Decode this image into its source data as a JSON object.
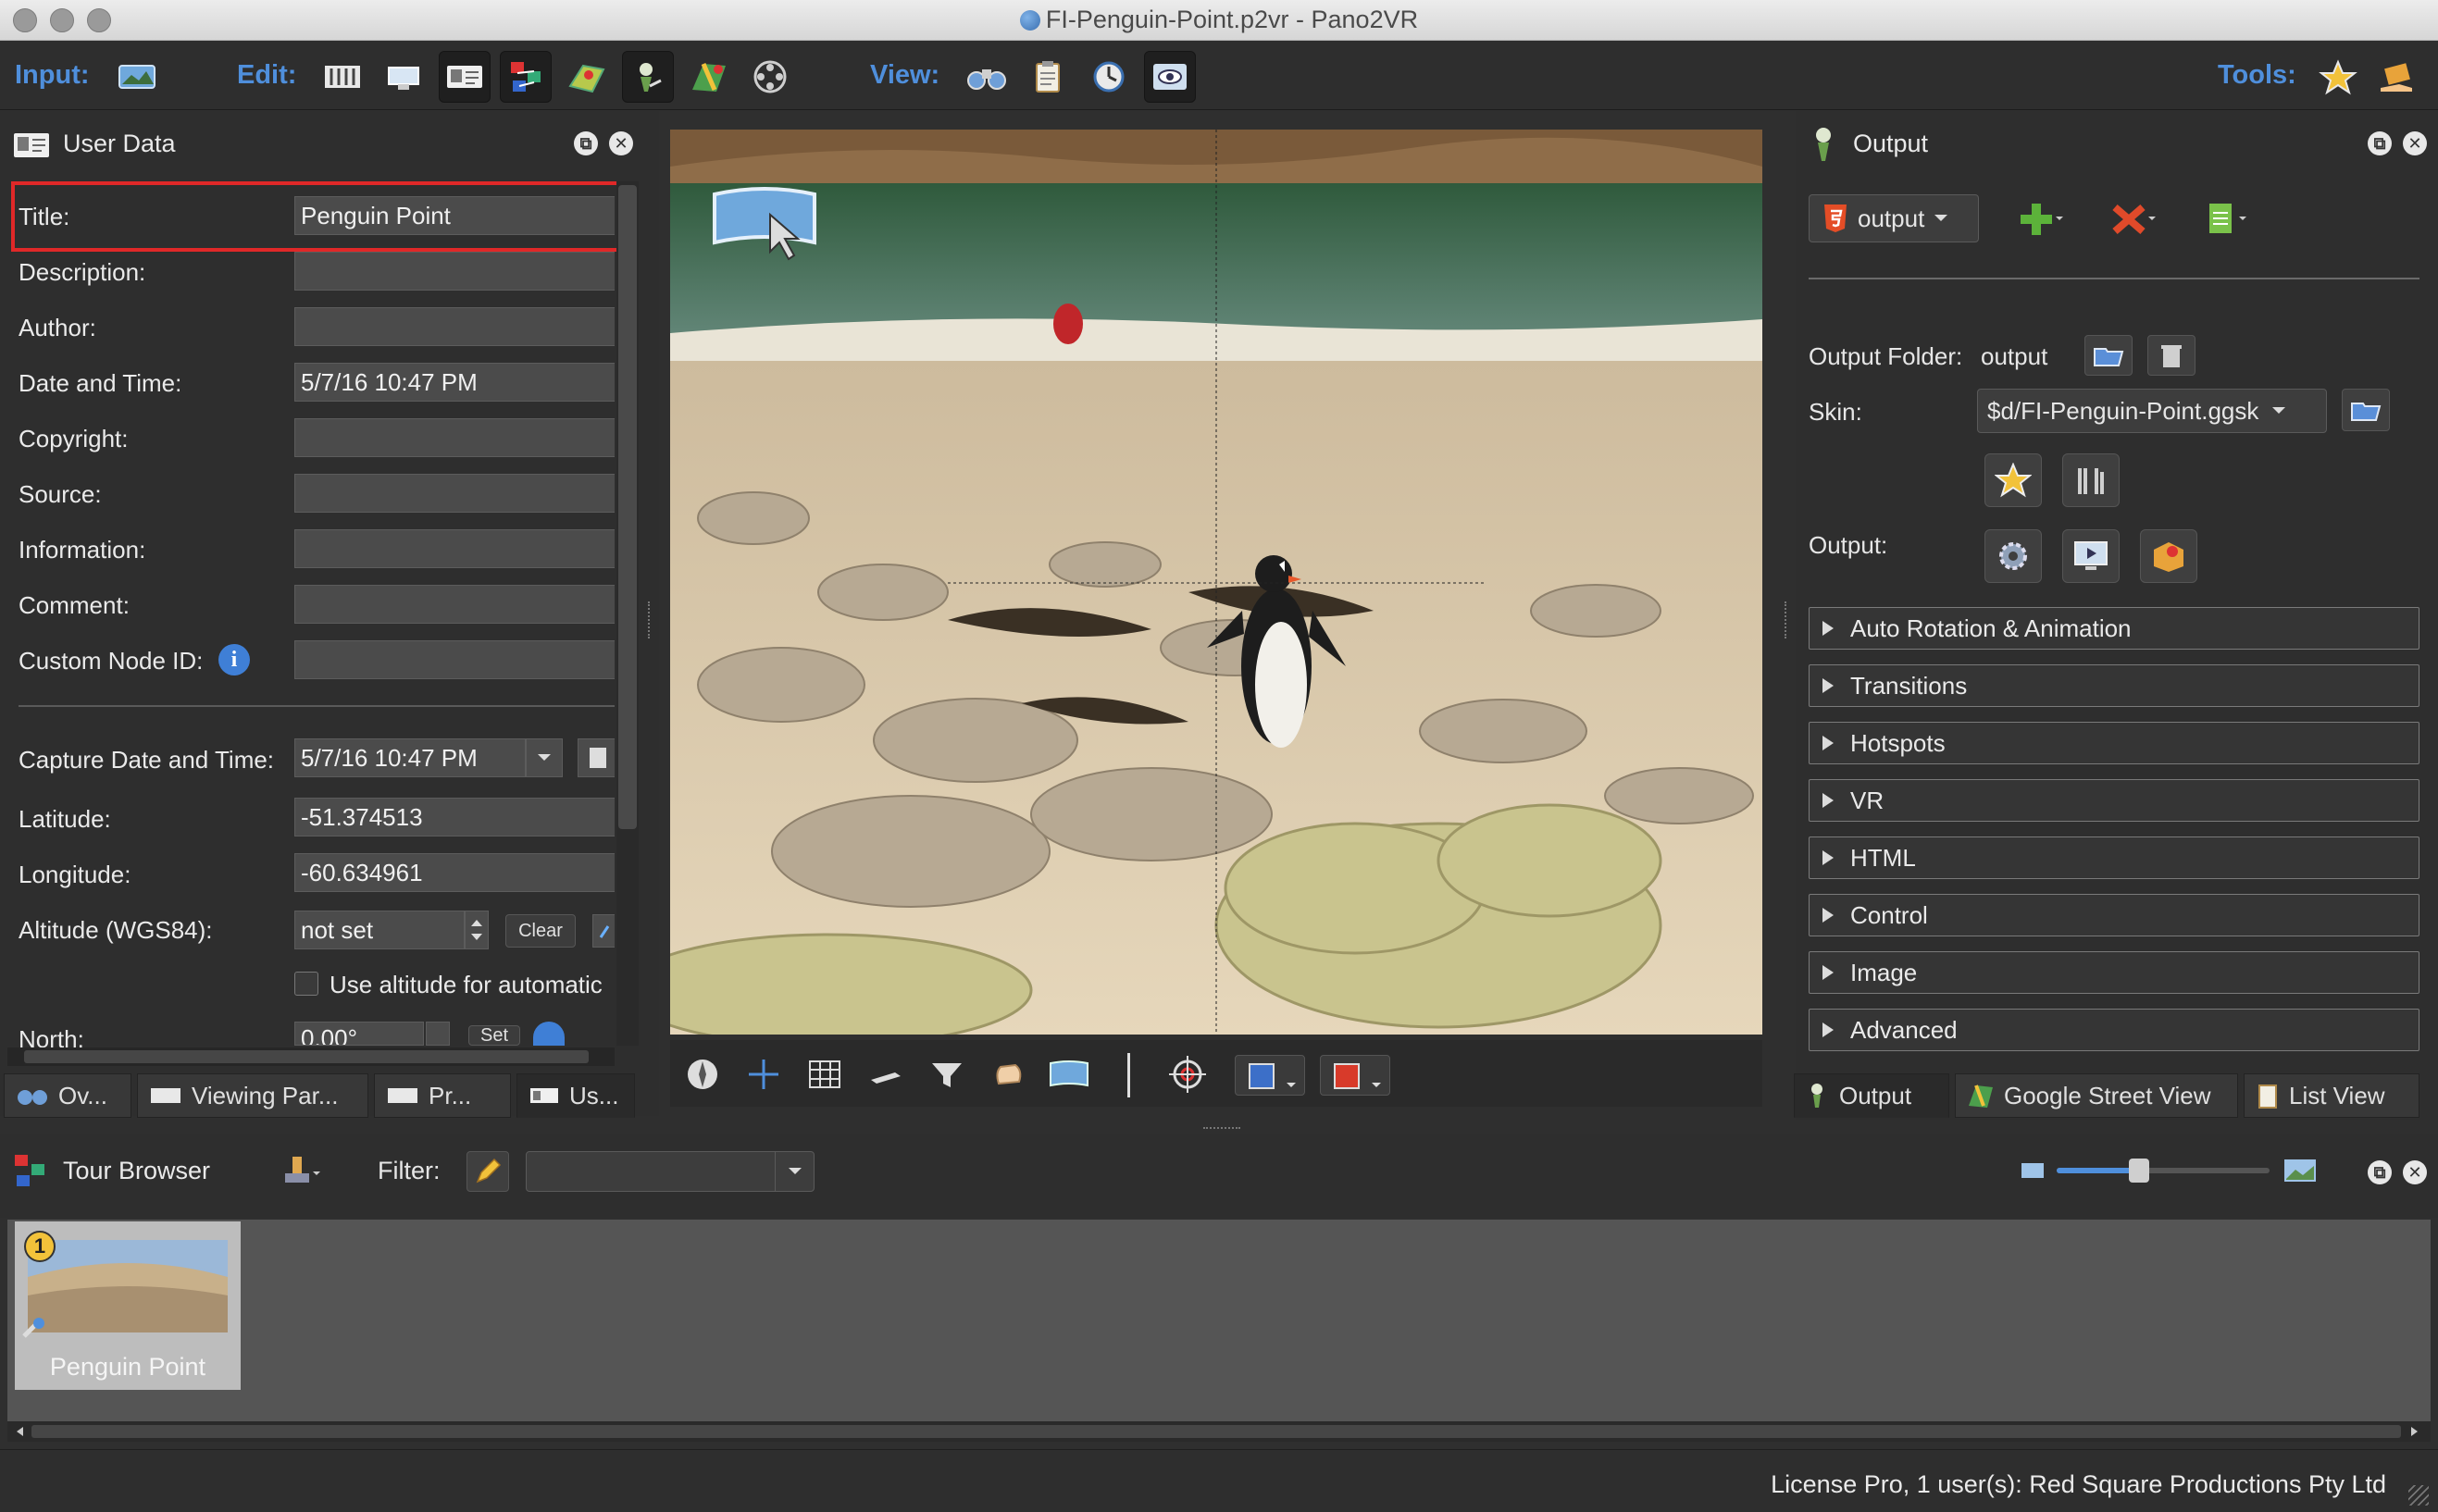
{
  "window": {
    "title": "FI-Penguin-Point.p2vr - Pano2VR"
  },
  "toolbar": {
    "input_label": "Input:",
    "edit_label": "Edit:",
    "view_label": "View:",
    "tools_label": "Tools:",
    "accent": "#4f8fdc"
  },
  "user_data": {
    "title": "User Data",
    "labels": {
      "title": "Title:",
      "description": "Description:",
      "author": "Author:",
      "datetime": "Date and Time:",
      "copyright": "Copyright:",
      "source": "Source:",
      "information": "Information:",
      "comment": "Comment:",
      "custom_node_id": "Custom Node ID:",
      "capture": "Capture Date and Time:",
      "latitude": "Latitude:",
      "longitude": "Longitude:",
      "altitude": "Altitude (WGS84):",
      "north": "North:"
    },
    "values": {
      "title": "Penguin Point",
      "description": "",
      "author": "",
      "datetime": "5/7/16 10:47 PM",
      "copyright": "",
      "source": "",
      "information": "",
      "comment": "",
      "custom_node_id": "",
      "capture": "5/7/16 10:47 PM",
      "latitude": "-51.374513",
      "longitude": "-60.634961",
      "altitude": "not set",
      "north": "0.00°"
    },
    "clear_label": "Clear",
    "set_label": "Set",
    "use_altitude_label": "Use altitude for automatic",
    "highlight_color": "#e02828"
  },
  "left_tabs": [
    "Ov...",
    "Viewing Par...",
    "Pr...",
    "Us..."
  ],
  "output": {
    "title": "Output",
    "dropdown_value": "output",
    "output_folder_label": "Output Folder:",
    "output_folder_value": "output",
    "skin_label": "Skin:",
    "skin_value": "$d/FI-Penguin-Point.ggsk",
    "output_label": "Output:",
    "sections": [
      "Auto Rotation & Animation",
      "Transitions",
      "Hotspots",
      "VR",
      "HTML",
      "Control",
      "Image",
      "Advanced"
    ]
  },
  "right_tabs": [
    "Output",
    "Google Street View",
    "List View"
  ],
  "tour_browser": {
    "title": "Tour Browser",
    "filter_label": "Filter:",
    "filter_value": "",
    "node_label": "Penguin Point",
    "node_badge": "1"
  },
  "status": {
    "license": "License Pro, 1 user(s): Red Square Productions Pty Ltd"
  }
}
